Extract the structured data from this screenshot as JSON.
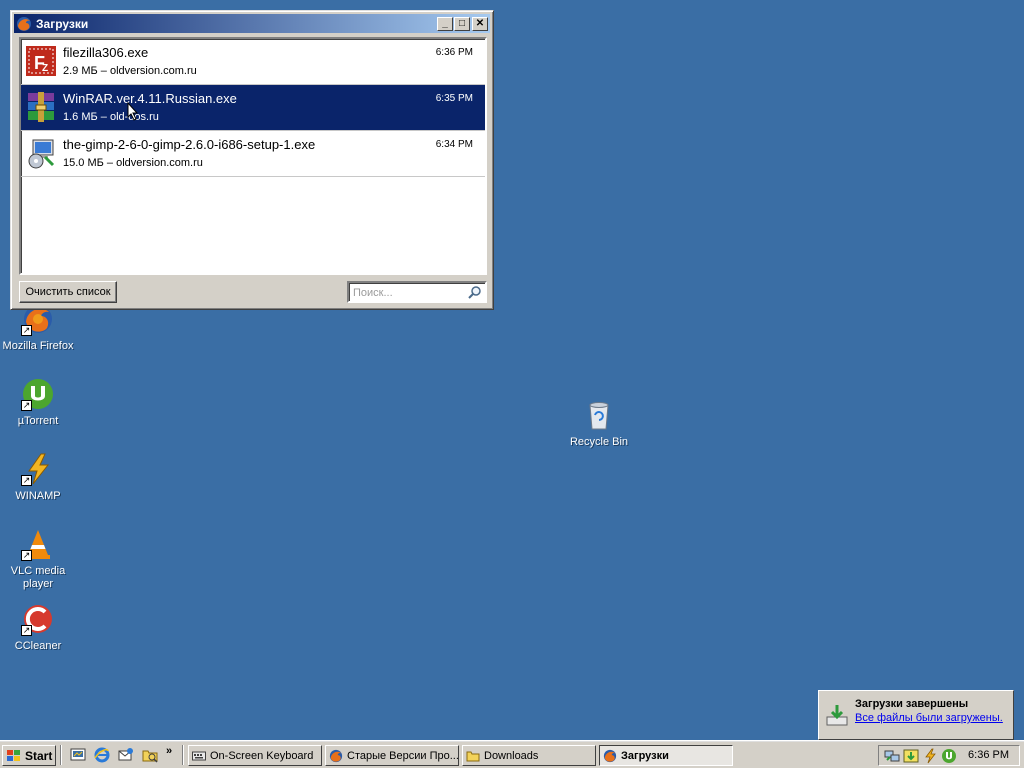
{
  "window": {
    "title": "Загрузки",
    "minimize_label": "_",
    "maximize_label": "□",
    "close_label": "✕",
    "downloads": [
      {
        "name": "filezilla306.exe",
        "info": "2.9 МБ – oldversion.com.ru",
        "time": "6:36 PM",
        "icon": "filezilla-icon"
      },
      {
        "name": "WinRAR.ver.4.11.Russian.exe",
        "info": "1.6 МБ – old-dos.ru",
        "time": "6:35 PM",
        "icon": "winrar-icon"
      },
      {
        "name": "the-gimp-2-6-0-gimp-2.6.0-i686-setup-1.exe",
        "info": "15.0 МБ – oldversion.com.ru",
        "time": "6:34 PM",
        "icon": "installer-icon"
      }
    ],
    "clear_button": "Очистить список",
    "search_placeholder": "Поиск..."
  },
  "desktop": {
    "icons": [
      {
        "label": "Mozilla Firefox",
        "icon": "firefox-icon"
      },
      {
        "label": "µTorrent",
        "icon": "utorrent-icon"
      },
      {
        "label": "WINAMP",
        "icon": "winamp-icon"
      },
      {
        "label": "VLC media player",
        "icon": "vlc-icon"
      },
      {
        "label": "CCleaner",
        "icon": "ccleaner-icon"
      },
      {
        "label": "Recycle Bin",
        "icon": "recycle-bin-icon"
      }
    ]
  },
  "notification": {
    "title": "Загрузки завершены",
    "message": "Все файлы были загружены."
  },
  "taskbar": {
    "start_label": "Start",
    "quick_launch_more": "»",
    "tasks": [
      {
        "label": "On-Screen Keyboard",
        "icon": "keyboard-icon"
      },
      {
        "label": "Старые Версии Про...",
        "icon": "firefox-icon"
      },
      {
        "label": "Downloads",
        "icon": "folder-icon"
      },
      {
        "label": "Загрузки",
        "icon": "firefox-icon"
      }
    ],
    "clock": "6:36 PM"
  },
  "colors": {
    "desktop": "#3a6ea5",
    "selection": "#0a246a",
    "face": "#d4d0c8"
  }
}
